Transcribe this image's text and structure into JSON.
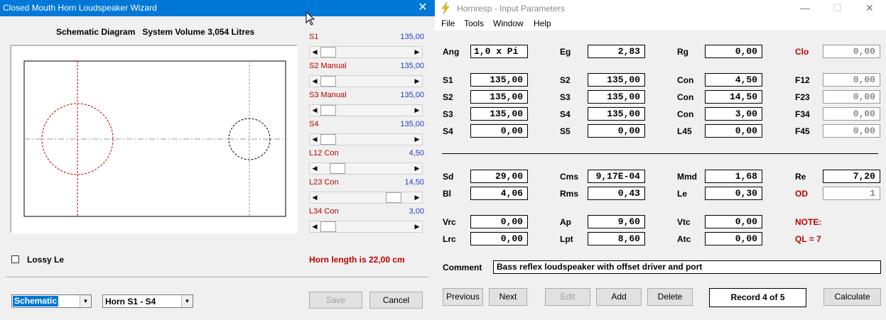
{
  "wizard": {
    "title": "Closed Mouth Horn Loudspeaker Wizard",
    "close_glyph": "✕",
    "schematic_heading": "Schematic Diagram   System Volume 3,054 Litres",
    "sliders": [
      {
        "label": "S1",
        "value": "135,00",
        "position_fraction": 0.0
      },
      {
        "label": "S2  Manual",
        "value": "135,00",
        "position_fraction": 0.0
      },
      {
        "label": "S3  Manual",
        "value": "135,00",
        "position_fraction": 0.0
      },
      {
        "label": "S4",
        "value": "135,00",
        "position_fraction": 0.0
      },
      {
        "label": "L12  Con",
        "value": "4,50",
        "position_fraction": 0.12
      },
      {
        "label": "L23  Con",
        "value": "14,50",
        "position_fraction": 0.85
      },
      {
        "label": "L34  Con",
        "value": "3,00",
        "position_fraction": 0.0
      }
    ],
    "lossy_le_label": "Lossy Le",
    "lossy_le_checked": false,
    "horn_length": "Horn length is 22,00 cm",
    "view_combo": "Schematic",
    "horn_combo": "Horn S1 - S4",
    "save_label": "Save",
    "cancel_label": "Cancel",
    "colors": {
      "titlebar": "#0078d7",
      "accent_red": "#c00000",
      "value_blue": "#1f3fbf"
    }
  },
  "hornresp": {
    "title": "Hornresp - Input Parameters",
    "menu": [
      "File",
      "Tools",
      "Window",
      "Help"
    ],
    "window_controls": {
      "minimize": "—",
      "maximize": "☐",
      "close": "✕"
    },
    "params": {
      "Ang": "1,0 x Pi",
      "Eg": "2,83",
      "Rg": "0,00",
      "Clo": "0,00",
      "S1": "135,00",
      "S2a": "135,00",
      "Con1": "4,50",
      "F12": "0,00",
      "S2": "135,00",
      "S3a": "135,00",
      "Con2": "14,50",
      "F23": "0,00",
      "S3": "135,00",
      "S4a": "135,00",
      "Con3": "3,00",
      "F34": "0,00",
      "S4": "0,00",
      "S5": "0,00",
      "L45": "0,00",
      "F45": "0,00",
      "Sd": "29,00",
      "Cms": "9,17E-04",
      "Mmd": "1,68",
      "Re": "7,20",
      "Bl": "4,06",
      "Rms": "0,43",
      "Le": "0,30",
      "OD": "1",
      "Vrc": "0,00",
      "Ap": "9,60",
      "Vtc": "0,00",
      "Lrc": "0,00",
      "Lpt": "8,60",
      "Atc": "0,00"
    },
    "labels": {
      "Ang": "Ang",
      "Eg": "Eg",
      "Rg": "Rg",
      "Clo": "Clo",
      "S1": "S1",
      "S2": "S2",
      "S3": "S3",
      "S4": "S4",
      "S5": "S5",
      "Con": "Con",
      "L45": "L45",
      "F12": "F12",
      "F23": "F23",
      "F34": "F34",
      "F45": "F45",
      "Sd": "Sd",
      "Cms": "Cms",
      "Mmd": "Mmd",
      "Re": "Re",
      "Bl": "Bl",
      "Rms": "Rms",
      "Le": "Le",
      "OD": "OD",
      "Vrc": "Vrc",
      "Ap": "Ap",
      "Vtc": "Vtc",
      "Lrc": "Lrc",
      "Lpt": "Lpt",
      "Atc": "Atc"
    },
    "note": "NOTE:",
    "ql": "QL = 7",
    "comment_label": "Comment",
    "comment": "Bass reflex loudspeaker with offset driver and port",
    "buttons": {
      "previous": "Previous",
      "next": "Next",
      "edit": "Edit",
      "add": "Add",
      "delete": "Delete",
      "calculate": "Calculate"
    },
    "record": "Record 4 of 5"
  }
}
